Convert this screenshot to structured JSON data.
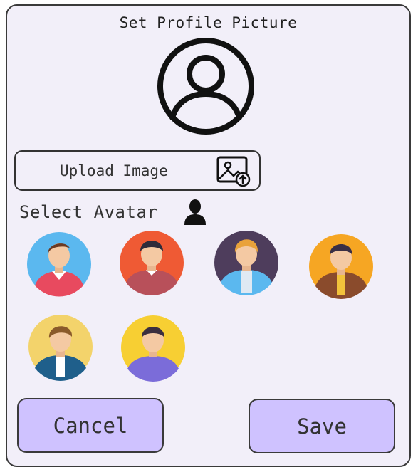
{
  "dialog": {
    "title": "Set Profile Picture",
    "profile_icon": "user-circle-icon",
    "upload": {
      "label": "Upload Image",
      "icon": "image-upload-icon"
    },
    "select_avatar": {
      "label": "Select Avatar",
      "icon": "person-silhouette-icon"
    },
    "avatars": [
      {
        "name": "avatar-1",
        "background": "#5bb8ef",
        "shirt": "#e84a5f",
        "hair": "#6b3a22"
      },
      {
        "name": "avatar-2",
        "background": "#ef5a34",
        "shirt": "#b8505a",
        "hair": "#2e2b3a"
      },
      {
        "name": "avatar-3",
        "background": "#4e3d5c",
        "shirt": "#5bb8ef",
        "hair": "#e9a23b"
      },
      {
        "name": "avatar-4",
        "background": "#f6a623",
        "shirt": "#8a4b2c",
        "hair": "#3a2f45"
      },
      {
        "name": "avatar-5",
        "background": "#f3d36b",
        "shirt": "#1f5f8b",
        "hair": "#8a5a2b"
      },
      {
        "name": "avatar-6",
        "background": "#f7cf33",
        "shirt": "#7b6cd9",
        "hair": "#3b2f3f"
      }
    ],
    "buttons": {
      "cancel": "Cancel",
      "save": "Save"
    },
    "colors": {
      "panel": "#f2eff9",
      "button": "#cfc2ff",
      "border": "#3a3a3a"
    }
  }
}
